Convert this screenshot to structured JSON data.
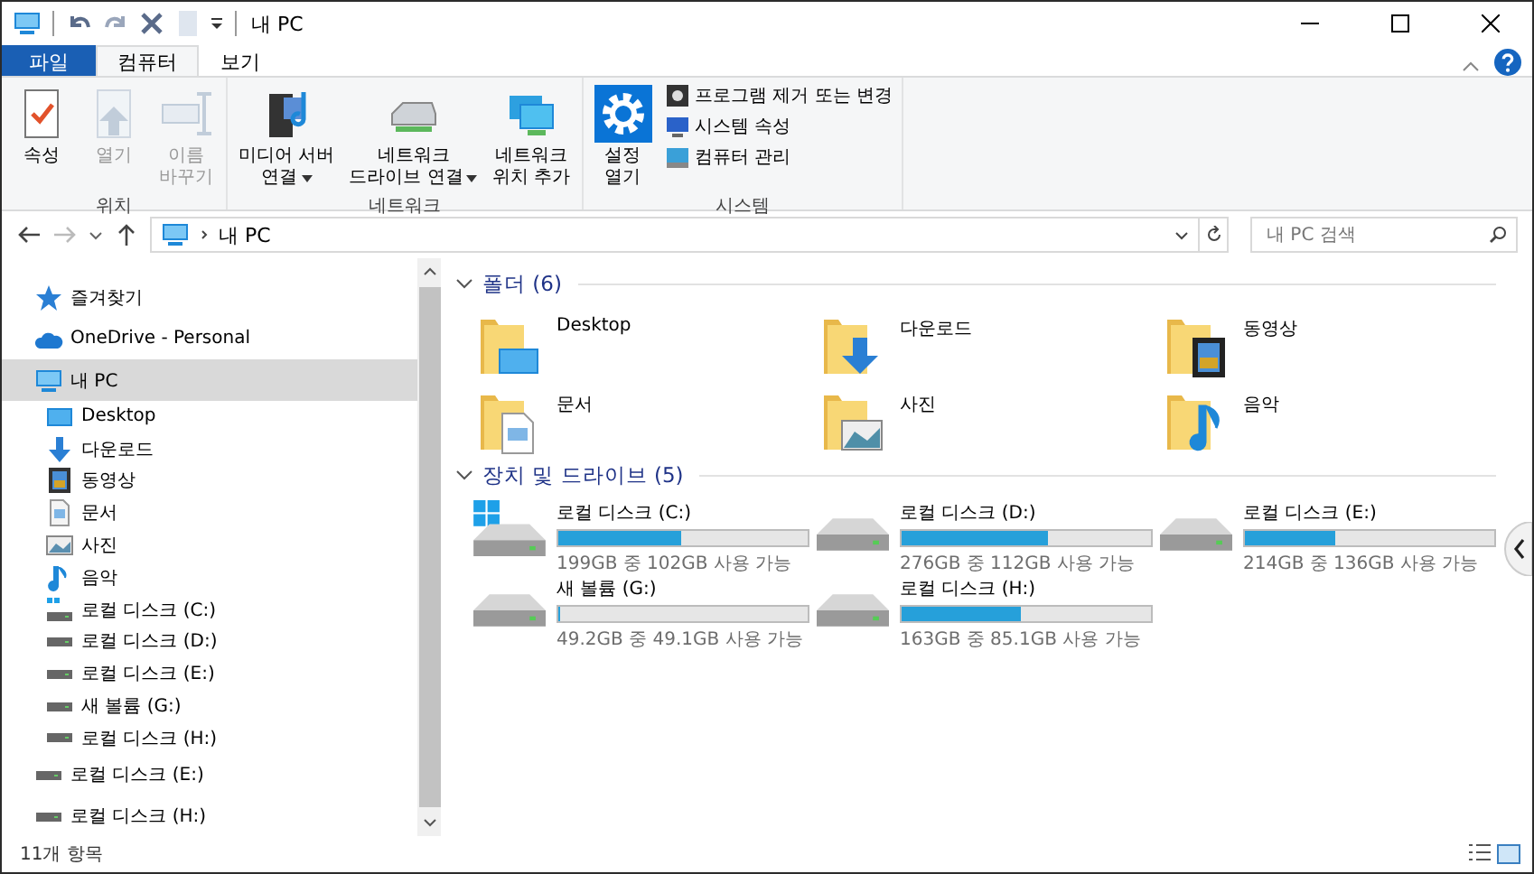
{
  "window": {
    "title": "내 PC"
  },
  "tabs": [
    {
      "label": "파일",
      "kind": "file",
      "selected": false
    },
    {
      "label": "컴퓨터",
      "kind": "tab",
      "selected": true
    },
    {
      "label": "보기",
      "kind": "tab",
      "selected": false
    }
  ],
  "ribbon": [
    {
      "name": "위치",
      "items": [
        {
          "kind": "large",
          "label": "속성",
          "disabled": false,
          "dropdown": false
        },
        {
          "kind": "large",
          "label": "열기",
          "disabled": true,
          "dropdown": false
        },
        {
          "kind": "large",
          "label": "이름\n바꾸기",
          "disabled": true,
          "dropdown": false
        }
      ]
    },
    {
      "name": "네트워크",
      "items": [
        {
          "kind": "large",
          "label": "미디어 서버\n연결",
          "disabled": false,
          "dropdown": true
        },
        {
          "kind": "large",
          "label": "네트워크\n드라이브 연결",
          "disabled": false,
          "dropdown": true
        },
        {
          "kind": "large",
          "label": "네트워크\n위치 추가",
          "disabled": false,
          "dropdown": false
        }
      ]
    },
    {
      "name": "시스템",
      "items": [
        {
          "kind": "large",
          "label": "설정\n열기",
          "disabled": false,
          "dropdown": false
        },
        {
          "kind": "small",
          "label": "프로그램 제거 또는 변경",
          "disabled": false,
          "dropdown": false
        },
        {
          "kind": "small",
          "label": "시스템 속성",
          "disabled": false,
          "dropdown": false
        },
        {
          "kind": "small",
          "label": "컴퓨터 관리",
          "disabled": false,
          "dropdown": false
        }
      ]
    }
  ],
  "address": {
    "path": "내 PC",
    "search_placeholder": "내 PC 검색"
  },
  "sidebar": {
    "items": [
      {
        "label": "즐겨찾기",
        "kind": "star",
        "selected": false
      },
      {
        "label": "OneDrive - Personal",
        "kind": "cloud",
        "selected": false
      },
      {
        "label": "내 PC",
        "kind": "pc",
        "selected": true,
        "children": [
          {
            "label": "Desktop",
            "kind": "desktop",
            "selected": false
          },
          {
            "label": "다운로드",
            "kind": "download",
            "selected": false
          },
          {
            "label": "동영상",
            "kind": "video",
            "selected": false
          },
          {
            "label": "문서",
            "kind": "document",
            "selected": false
          },
          {
            "label": "사진",
            "kind": "picture",
            "selected": false
          },
          {
            "label": "음악",
            "kind": "music",
            "selected": false
          },
          {
            "label": "로컬 디스크 (C:)",
            "kind": "sysdrive",
            "selected": false
          },
          {
            "label": "로컬 디스크 (D:)",
            "kind": "drive",
            "selected": false
          },
          {
            "label": "로컬 디스크 (E:)",
            "kind": "drive",
            "selected": false
          },
          {
            "label": "새 볼륨 (G:)",
            "kind": "drive",
            "selected": false
          },
          {
            "label": "로컬 디스크 (H:)",
            "kind": "drive",
            "selected": false
          }
        ]
      },
      {
        "label": "로컬 디스크 (E:)",
        "kind": "drive",
        "selected": false
      },
      {
        "label": "로컬 디스크 (H:)",
        "kind": "drive",
        "selected": false
      }
    ]
  },
  "folders": {
    "title": "폴더 (6)",
    "expanded": true,
    "items": [
      {
        "label": "Desktop",
        "kind": "desktop"
      },
      {
        "label": "다운로드",
        "kind": "download"
      },
      {
        "label": "동영상",
        "kind": "video"
      },
      {
        "label": "문서",
        "kind": "document"
      },
      {
        "label": "사진",
        "kind": "picture"
      },
      {
        "label": "음악",
        "kind": "music"
      }
    ]
  },
  "drives": {
    "title": "장치 및 드라이브 (5)",
    "expanded": true,
    "items": [
      {
        "label": "로컬 디스크 (C:)",
        "kind": "sysdrive",
        "level": 0.49,
        "info": "199GB 중 102GB 사용 가능"
      },
      {
        "label": "로컬 디스크 (D:)",
        "kind": "drive",
        "level": 0.59,
        "info": "276GB 중 112GB 사용 가능"
      },
      {
        "label": "로컬 디스크 (E:)",
        "kind": "drive",
        "level": 0.36,
        "info": "214GB 중 136GB 사용 가능"
      },
      {
        "label": "새 볼륨 (G:)",
        "kind": "drive",
        "level": 0.01,
        "info": "49.2GB 중 49.1GB 사용 가능"
      },
      {
        "label": "로컬 디스크 (H:)",
        "kind": "drive",
        "level": 0.48,
        "info": "163GB 중 85.1GB 사용 가능"
      }
    ]
  },
  "status_bar": {
    "count": "11개 항목"
  }
}
